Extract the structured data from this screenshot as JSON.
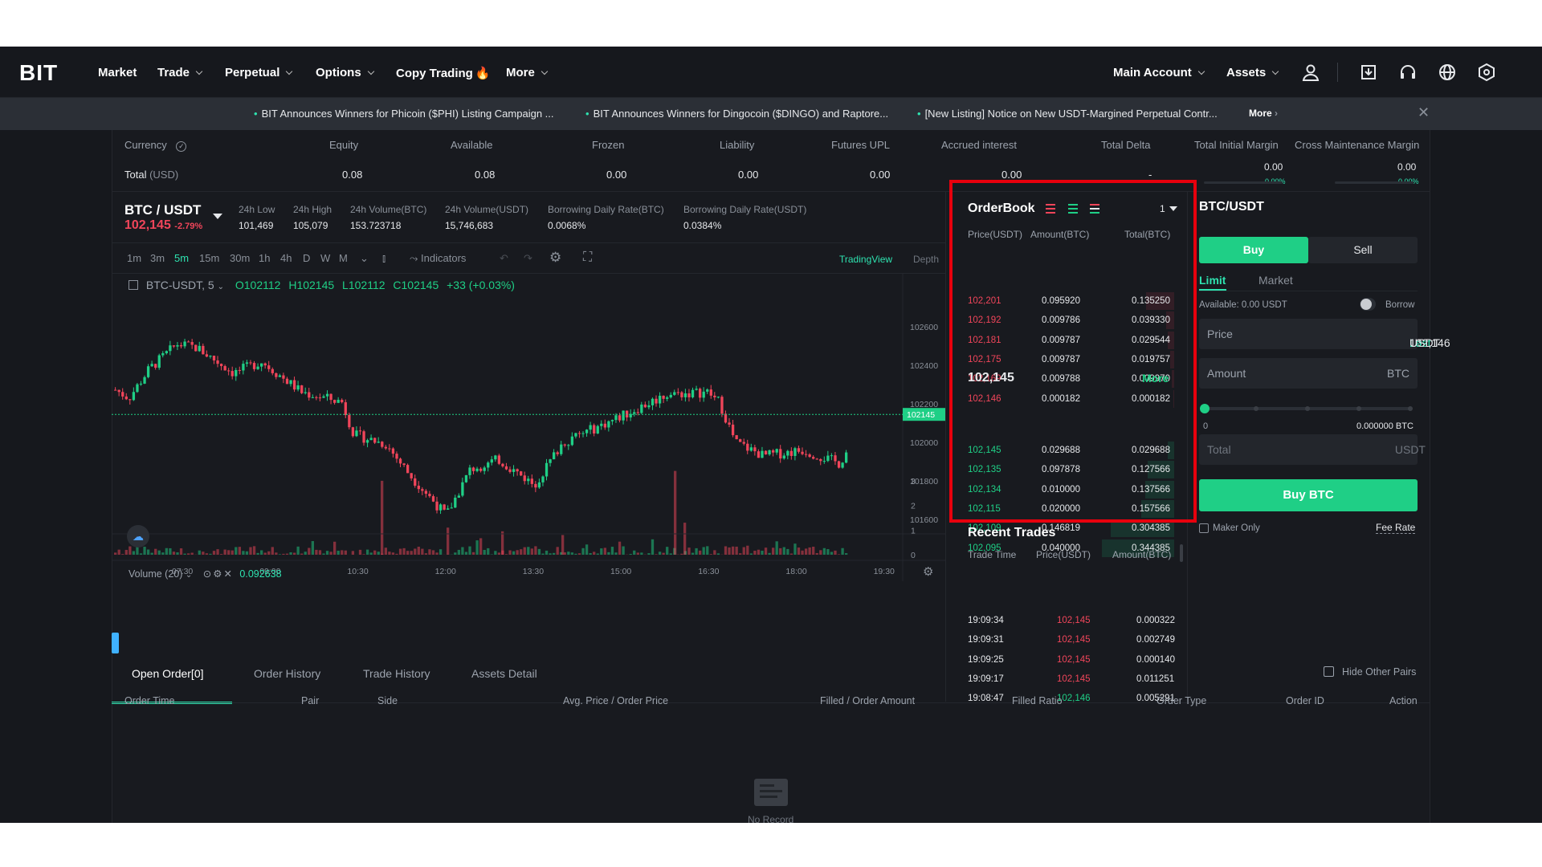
{
  "nav": {
    "logo": "BIT",
    "items": [
      {
        "label": "Market",
        "chevron": false
      },
      {
        "label": "Trade",
        "chevron": true
      },
      {
        "label": "Perpetual",
        "chevron": true
      },
      {
        "label": "Options",
        "chevron": true
      },
      {
        "label": "Copy Trading",
        "chevron": false
      },
      {
        "label": "More",
        "chevron": true
      }
    ],
    "main_account": "Main Account",
    "assets": "Assets",
    "icons": [
      "user-icon",
      "download-icon",
      "headset-icon",
      "globe-icon",
      "settings-icon"
    ]
  },
  "ticker": {
    "items": [
      "BIT Announces Winners for Phicoin ($PHI) Listing Campaign ...",
      "BIT Announces Winners for Dingocoin ($DINGO) and Raptore...",
      "[New Listing] Notice on New USDT-Margined Perpetual Contr..."
    ],
    "more": "More"
  },
  "account": {
    "headers": [
      "Currency",
      "Equity",
      "Available",
      "Frozen",
      "Liability",
      "Futures UPL",
      "Accrued interest",
      "Total Delta",
      "Total Initial Margin",
      "Cross Maintenance Margin"
    ],
    "total_label": "Total",
    "total_unit": "(USD)",
    "values": [
      "0.08",
      "0.08",
      "0.00",
      "0.00",
      "0.00",
      "0.00",
      "-"
    ],
    "margin_values": [
      "0.00",
      "0.00"
    ],
    "margin_pcts": [
      "0.00%",
      "0.00%"
    ]
  },
  "pair": {
    "name": "BTC / USDT",
    "price": "102,145",
    "change": "-2.79%",
    "stats": [
      {
        "label": "24h Low",
        "value": "101,469"
      },
      {
        "label": "24h High",
        "value": "105,079"
      },
      {
        "label": "24h Volume(BTC)",
        "value": "153.723718"
      },
      {
        "label": "24h Volume(USDT)",
        "value": "15,746,683"
      },
      {
        "label": "Borrowing Daily Rate(BTC)",
        "value": "0.0068%"
      },
      {
        "label": "Borrowing Daily Rate(USDT)",
        "value": "0.0384%"
      }
    ]
  },
  "chart_toolbar": {
    "timeframes": [
      "1m",
      "3m",
      "5m",
      "15m",
      "30m",
      "1h",
      "4h",
      "D",
      "W",
      "M"
    ],
    "active": "5m",
    "indicators": "Indicators",
    "tradingview": "TradingView",
    "depth": "Depth"
  },
  "chart_legend": {
    "symbol": "BTC-USDT, 5",
    "open": "O102112",
    "high": "H102145",
    "low": "L102112",
    "close": "C102145",
    "change": "+33 (+0.03%)",
    "volume_label": "Volume (20)",
    "volume_value": "0.092638"
  },
  "chart_data": {
    "type": "candlestick",
    "y_ticks": [
      "102600",
      "102400",
      "102200",
      "102000",
      "101800",
      "101600"
    ],
    "last_price_label": "102145",
    "volume_ticks": [
      "3",
      "2",
      "1",
      "0"
    ],
    "x_ticks": [
      "07:30",
      "09:00",
      "10:30",
      "12:00",
      "13:30",
      "15:00",
      "16:30",
      "18:00",
      "19:30"
    ]
  },
  "orderbook": {
    "title": "OrderBook",
    "precision": "1",
    "headers": [
      "Price(USDT)",
      "Amount(BTC)",
      "Total(BTC)"
    ],
    "asks": [
      [
        "102,201",
        "0.095920",
        "0.135250",
        0.39
      ],
      [
        "102,192",
        "0.009786",
        "0.039330",
        0.11
      ],
      [
        "102,181",
        "0.009787",
        "0.029544",
        0.09
      ],
      [
        "102,175",
        "0.009787",
        "0.019757",
        0.06
      ],
      [
        "102,169",
        "0.009788",
        "0.009970",
        0.03
      ],
      [
        "102,146",
        "0.000182",
        "0.000182",
        0.01
      ]
    ],
    "mid_price": "102,145",
    "more": "More",
    "bids": [
      [
        "102,145",
        "0.029688",
        "0.029688",
        0.09
      ],
      [
        "102,135",
        "0.097878",
        "0.127566",
        0.37
      ],
      [
        "102,134",
        "0.010000",
        "0.137566",
        0.4
      ],
      [
        "102,115",
        "0.020000",
        "0.157566",
        0.46
      ],
      [
        "102,109",
        "0.146819",
        "0.304385",
        0.88
      ],
      [
        "102,095",
        "0.040000",
        "0.344385",
        1.0
      ]
    ]
  },
  "recent_trades": {
    "title": "Recent Trades",
    "headers": [
      "Trade Time",
      "Price(USDT)",
      "Amount(BTC)"
    ],
    "rows": [
      [
        "19:09:34",
        "102,145",
        "0.000322",
        "red"
      ],
      [
        "19:09:31",
        "102,145",
        "0.002749",
        "red"
      ],
      [
        "19:09:25",
        "102,145",
        "0.000140",
        "red"
      ],
      [
        "19:09:17",
        "102,145",
        "0.011251",
        "red"
      ],
      [
        "19:08:47",
        "102,146",
        "0.005291",
        "green"
      ]
    ]
  },
  "order_form": {
    "pair": "BTC/USDT",
    "buy": "Buy",
    "sell": "Sell",
    "limit": "Limit",
    "market": "Market",
    "available": "Available: 0.00 USDT",
    "borrow": "Borrow",
    "price_label": "Price",
    "price_value": "102,146",
    "last": "Last",
    "price_unit": "USDT",
    "amount_label": "Amount",
    "amount_unit": "BTC",
    "slider_min": "0",
    "slider_value": "0.000000 BTC",
    "total_label": "Total",
    "total_unit": "USDT",
    "submit": "Buy BTC",
    "maker_only": "Maker Only",
    "fee_rate": "Fee Rate"
  },
  "bottom": {
    "tabs": [
      "Open Order[0]",
      "Order History",
      "Trade History",
      "Assets Detail"
    ],
    "hide_pairs": "Hide Other Pairs",
    "headers": [
      "Order Time",
      "Pair",
      "Side",
      "Avg. Price / Order Price",
      "Filled / Order Amount",
      "Filled Ratio",
      "Order Type",
      "Order ID",
      "Action"
    ],
    "empty": "No Record"
  },
  "colors": {
    "up": "#1fcf86",
    "down": "#f0455a",
    "accent": "#2ee3b0",
    "box": "#e8000d"
  }
}
